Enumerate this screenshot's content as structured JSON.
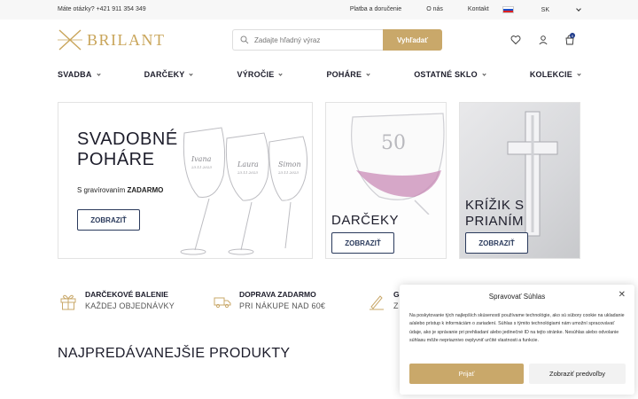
{
  "topbar": {
    "phone": "Máte otázky? +421 911 354 349",
    "links": [
      "Platba a doručenie",
      "O nás",
      "Kontakt"
    ],
    "lang": "SK"
  },
  "header": {
    "logo": "BRILANT",
    "search_placeholder": "Zadajte hľadný výraz",
    "search_button": "Vyhľadať",
    "cart_count": "0"
  },
  "nav": [
    "SVADBA",
    "DARČEKY",
    "VÝROČIE",
    "POHÁRE",
    "OSTATNÉ SKLO",
    "KOLEKCIE"
  ],
  "banners": {
    "main": {
      "title_line1": "SVADOBNÉ",
      "title_line2": "POHÁRE",
      "subtitle_prefix": "S gravírovaním",
      "subtitle_bold": "ZADARMO",
      "button": "ZOBRAZIŤ",
      "engraving_left": "Ivana",
      "engraving_mid": "Laura",
      "engraving_right": "Simon",
      "engraving_date": "23.11.2023"
    },
    "gifts": {
      "caption": "DARČEKY",
      "button": "ZOBRAZIŤ",
      "glass_number": "50"
    },
    "cross": {
      "caption_line1": "KRÍŽIK S",
      "caption_line2": "PRIANÍM",
      "button": "ZOBRAZIŤ"
    }
  },
  "perks": [
    {
      "title": "DARČEKOVÉ BALENIE",
      "desc": "KAŽDEJ OBJEDNÁVKY",
      "icon": "gift-icon"
    },
    {
      "title": "DOPRAVA ZADARMO",
      "desc": "PRI NÁKUPE NAD 60€",
      "icon": "truck-icon"
    },
    {
      "title": "G",
      "desc": "Z",
      "icon": "engraving-pen-icon"
    }
  ],
  "section_title": "NAJPREDÁVANEJŠIE PRODUKTY",
  "cookie": {
    "title": "Spravovať Súhlas",
    "close": "✕",
    "body": "Na poskytovanie tých najlepších skúseností používame technológie, ako sú súbory cookie na ukladanie a/alebo prístup k informáciám o zariadení. Súhlas s týmito technológiami nám umožní spracovávať údaje, ako je správanie pri prehliadaní alebo jedinečné ID na tejto stránke. Nesúhlas alebo odvolanie súhlasu môže nepriaznivo ovplyvniť určité vlastnosti a funkcie.",
    "accept": "Prijať",
    "preferences": "Zobraziť predvoľby"
  },
  "colors": {
    "gold": "#c9a86a",
    "navy": "#2a3a5c",
    "text": "#1d1d2b"
  }
}
